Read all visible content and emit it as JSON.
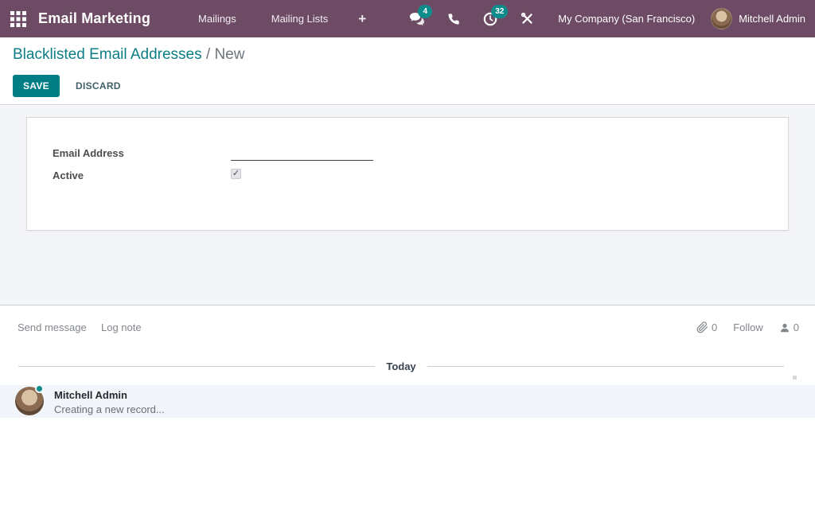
{
  "header": {
    "app_title": "Email Marketing",
    "menus": [
      {
        "label": "Mailings"
      },
      {
        "label": "Mailing Lists"
      }
    ],
    "add_menu_glyph": "+",
    "systray": {
      "messages_count": "4",
      "activities_count": "32",
      "company": "My Company (San Francisco)",
      "user": "Mitchell Admin"
    }
  },
  "breadcrumb": {
    "parent": "Blacklisted Email Addresses",
    "separator": "/",
    "current": "New"
  },
  "actions": {
    "save": "SAVE",
    "discard": "DISCARD"
  },
  "form": {
    "fields": [
      {
        "label": "Email Address",
        "value": "",
        "placeholder": ""
      },
      {
        "label": "Active",
        "checked": true,
        "check_glyph": "✓"
      }
    ]
  },
  "chatter": {
    "send_message": "Send message",
    "log_note": "Log note",
    "attachments_count": "0",
    "follow_label": "Follow",
    "followers_count": "0",
    "date_separator": "Today",
    "messages": [
      {
        "author": "Mitchell Admin",
        "body": "Creating a new record..."
      }
    ]
  },
  "colors": {
    "header_bg": "#6e4b64",
    "badge_teal": "#0e8c8c",
    "primary_teal": "#017e84",
    "link_teal": "#0d7e85",
    "content_bg": "#f4f5f8",
    "message_row_bg": "#f2f5f9",
    "muted_text": "#83878c"
  }
}
